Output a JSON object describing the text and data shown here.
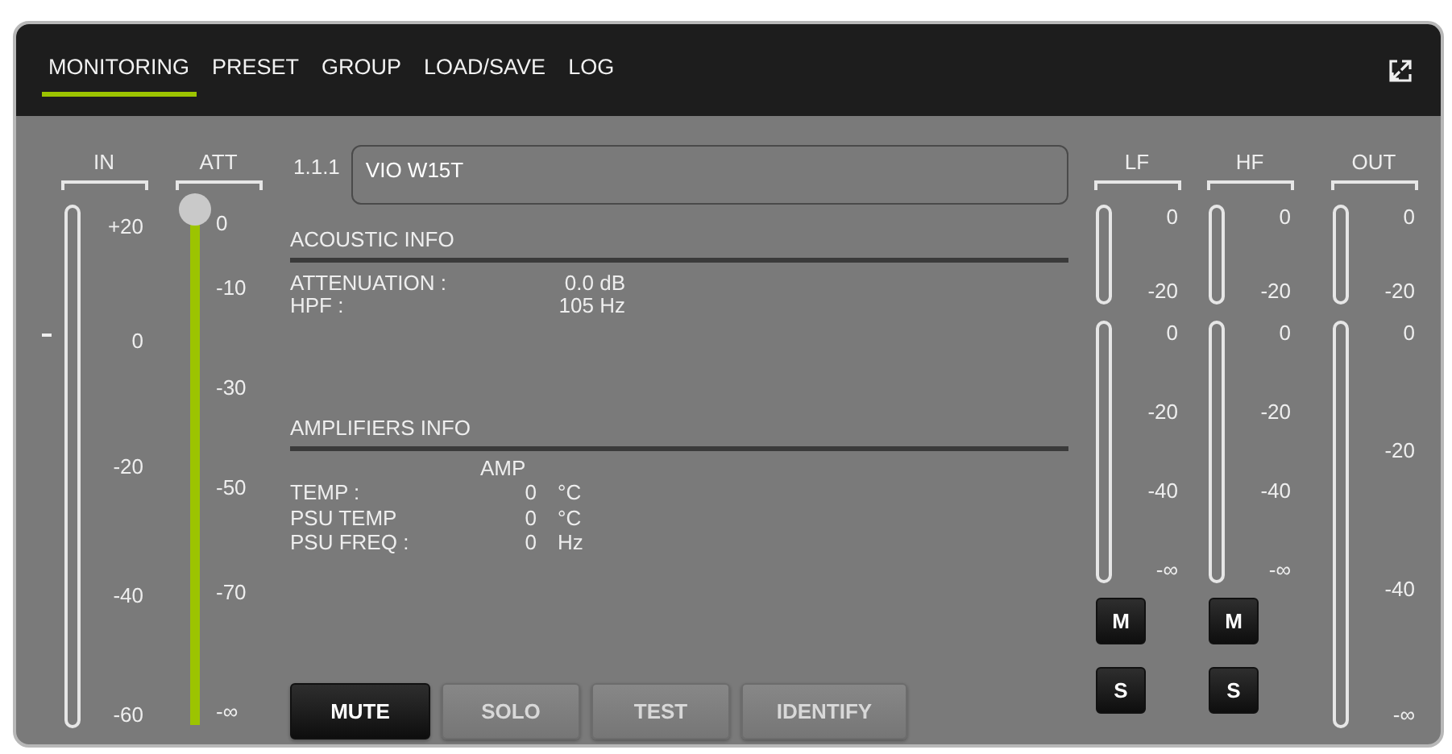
{
  "tabs": [
    {
      "label": "MONITORING",
      "selected": true
    },
    {
      "label": "PRESET",
      "selected": false
    },
    {
      "label": "GROUP",
      "selected": false
    },
    {
      "label": "LOAD/SAVE",
      "selected": false
    },
    {
      "label": "LOG",
      "selected": false
    }
  ],
  "in_meter": {
    "title": "IN",
    "scale": [
      "+20",
      "0",
      "-20",
      "-40",
      "-60"
    ]
  },
  "att_slider": {
    "title": "ATT",
    "level": 1,
    "scale": [
      "0",
      "-10",
      "-30",
      "-50",
      "-70",
      "-∞"
    ]
  },
  "channel": {
    "index": "1.1.1",
    "name": "VIO W15T"
  },
  "acoustic_info": {
    "title": "ACOUSTIC INFO",
    "rows": [
      {
        "label": "ATTENUATION :",
        "value": "0.0 dB"
      },
      {
        "label": "HPF :",
        "value": "105 Hz"
      }
    ]
  },
  "amplifiers_info": {
    "title": "AMPLIFIERS INFO",
    "column": "AMP",
    "rows": [
      {
        "label": "TEMP :",
        "value": "0",
        "unit": "°C"
      },
      {
        "label": "PSU TEMP",
        "value": "0",
        "unit": "°C"
      },
      {
        "label": "PSU FREQ :",
        "value": "0",
        "unit": "Hz"
      }
    ]
  },
  "buttons": [
    {
      "label": "MUTE",
      "on": true
    },
    {
      "label": "SOLO",
      "on": false
    },
    {
      "label": "TEST",
      "on": false
    },
    {
      "label": "IDENTIFY",
      "on": false
    }
  ],
  "bands": [
    {
      "title": "LF",
      "meters": [
        {
          "scale": [
            "0",
            "-20"
          ]
        },
        {
          "scale": [
            "0",
            "-20",
            "-40",
            "-∞"
          ]
        }
      ],
      "buttons": [
        "M",
        "S"
      ]
    },
    {
      "title": "HF",
      "meters": [
        {
          "scale": [
            "0",
            "-20"
          ]
        },
        {
          "scale": [
            "0",
            "-20",
            "-40",
            "-∞"
          ]
        }
      ],
      "buttons": [
        "M",
        "S"
      ]
    }
  ],
  "out_meter": {
    "title": "OUT",
    "meters": [
      {
        "scale": [
          "0",
          "-20"
        ]
      },
      {
        "scale": [
          "0",
          "-20",
          "-40",
          "-∞"
        ]
      }
    ]
  }
}
